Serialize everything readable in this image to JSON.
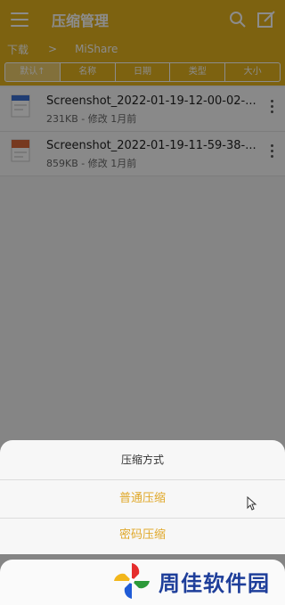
{
  "app": {
    "title": "压缩管理",
    "breadcrumb": [
      "下载",
      "MiShare"
    ],
    "sort_tabs": [
      "默认↑",
      "名称",
      "日期",
      "类型",
      "大小"
    ]
  },
  "files": [
    {
      "name": "Screenshot_2022-01-19-12-00-02-...",
      "meta": "231KB - 修改 1月前",
      "thumb_color": "#3b6fd1"
    },
    {
      "name": "Screenshot_2022-01-19-11-59-38-...",
      "meta": "859KB - 修改 1月前",
      "thumb_color": "#d9683a"
    }
  ],
  "dialog": {
    "title": "压缩方式",
    "options": [
      "普通压缩",
      "密码压缩"
    ]
  },
  "watermark": {
    "text": "周佳软件园"
  },
  "colors": {
    "accent": "#e3b21e",
    "option_text": "#e0a82a"
  }
}
